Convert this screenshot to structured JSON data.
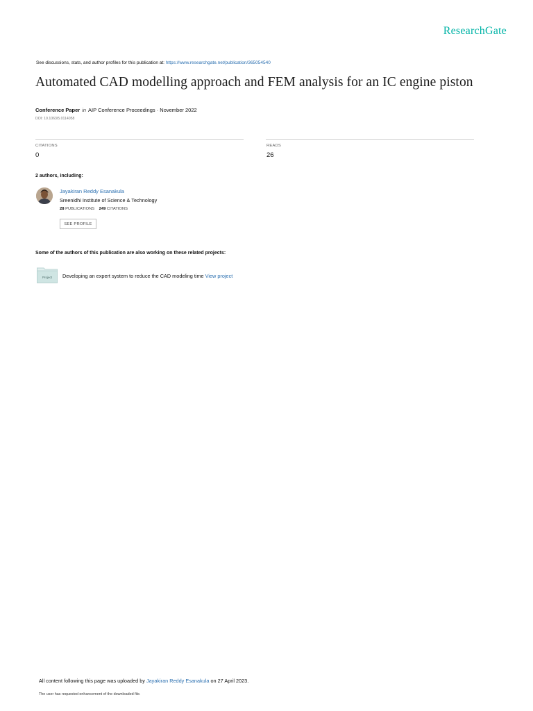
{
  "brand": "ResearchGate",
  "discussion": {
    "prefix": "See discussions, stats, and author profiles for this publication at:",
    "url": "https://www.researchgate.net/publication/365054540"
  },
  "title": "Automated CAD modelling approach and FEM analysis for an IC engine piston",
  "meta": {
    "type": "Conference Paper",
    "in": "in",
    "venue": "AIP Conference Proceedings · November 2022"
  },
  "doi": "DOI: 10.1063/5.0114058",
  "stats": {
    "citations_label": "CITATIONS",
    "citations_value": "0",
    "reads_label": "READS",
    "reads_value": "26"
  },
  "authors_heading": "2 authors, including:",
  "author": {
    "name": "Jayakiran Reddy Esanakula",
    "institution": "Sreenidhi Institute of Science & Technology",
    "publications_count": "28",
    "publications_label": "PUBLICATIONS",
    "citations_count": "249",
    "citations_label": "CITATIONS",
    "see_profile": "SEE PROFILE"
  },
  "related": {
    "heading": "Some of the authors of this publication are also working on these related projects:",
    "folder_label": "Project",
    "project_text": "Developing an expert system to reduce the CAD modeling time",
    "view_project": "View project"
  },
  "footer": {
    "prefix": "All content following this page was uploaded by",
    "uploader": "Jayakiran Reddy Esanakula",
    "suffix": "on 27 April 2023.",
    "note": "The user has requested enhancement of the downloaded file."
  },
  "colors": {
    "brand": "#00b3a6",
    "link": "#2a6fb0"
  }
}
